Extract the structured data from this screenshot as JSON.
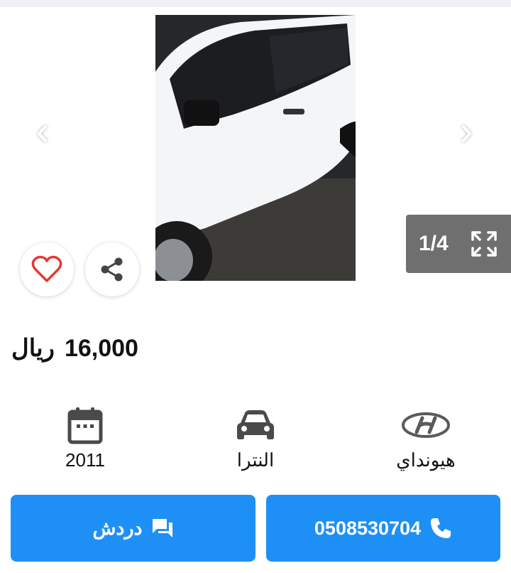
{
  "gallery": {
    "counter": "1/4",
    "image_alt": "white car photo"
  },
  "listing": {
    "price_value": "16,000",
    "price_currency": "ريال"
  },
  "specs": {
    "year": "2011",
    "model": "النترا",
    "make": "هيونداي"
  },
  "actions": {
    "chat_label": "دردش",
    "phone_label": "0508530704"
  },
  "icons": {
    "prev": "chevron-left-icon",
    "next": "chevron-right-icon",
    "fullscreen": "fullscreen-icon",
    "favorite": "heart-icon",
    "share": "share-icon",
    "calendar": "calendar-icon",
    "car": "car-icon",
    "brand": "hyundai-logo-icon",
    "chat": "chat-icon",
    "phone": "phone-icon"
  },
  "colors": {
    "primary": "#1e90f5",
    "heart": "#e53935",
    "counter_bg": "#6f6f6f"
  }
}
